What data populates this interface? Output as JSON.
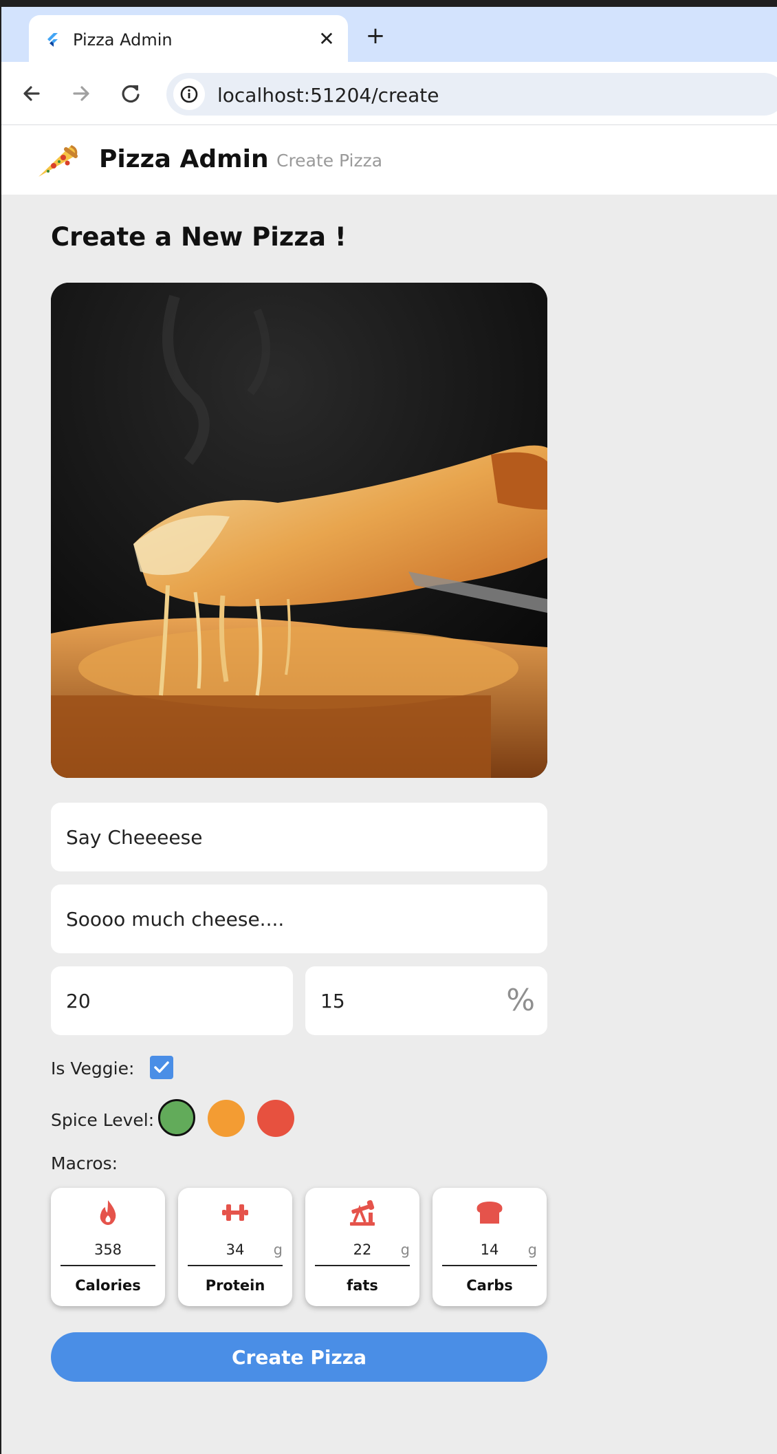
{
  "browser": {
    "tab_title": "Pizza Admin",
    "tab_close": "✕",
    "new_tab": "+",
    "url": "localhost:51204/create"
  },
  "app": {
    "title": "Pizza Admin",
    "nav_create": "Create Pizza",
    "logo_icon": "pizza-slice-icon"
  },
  "form": {
    "heading": "Create a New Pizza !",
    "name_value": "Say Cheeeese",
    "description_value": "Soooo much cheese....",
    "price_value": "20",
    "discount_value": "15",
    "discount_suffix": "%",
    "veggie_label": "Is Veggie:",
    "veggie_checked": true,
    "spice_label": "Spice Level:",
    "spice_colors": [
      "#62ab5a",
      "#f39c33",
      "#e7513f"
    ],
    "spice_selected": "mild",
    "macros_label": "Macros:",
    "macros": [
      {
        "icon": "flame-icon",
        "value": "358",
        "unit": "",
        "label": "Calories"
      },
      {
        "icon": "dumbbell-icon",
        "value": "34",
        "unit": "g",
        "label": "Protein"
      },
      {
        "icon": "oil-pump-icon",
        "value": "22",
        "unit": "g",
        "label": "fats"
      },
      {
        "icon": "bread-icon",
        "value": "14",
        "unit": "g",
        "label": "Carbs"
      }
    ],
    "submit_label": "Create Pizza"
  },
  "colors": {
    "accent": "#4a8ee6",
    "macro_icon": "#e5534b",
    "background": "#ececec"
  }
}
